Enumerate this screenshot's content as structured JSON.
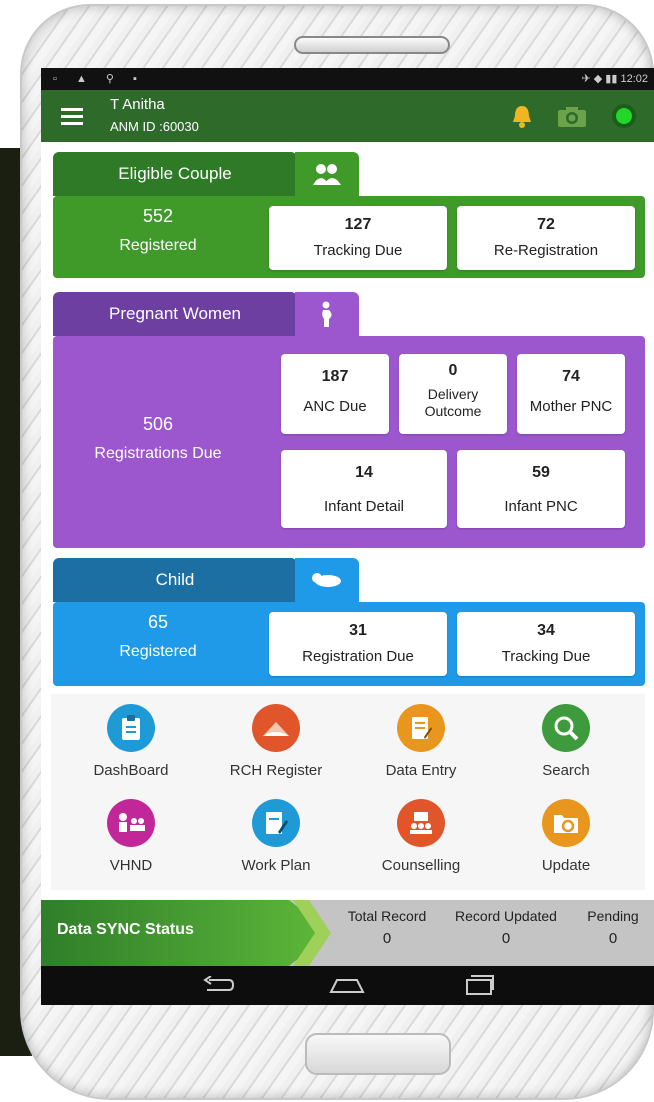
{
  "status_bar": {
    "left_icons": "▫ ▲ ⚲ ▪",
    "time": "12:02"
  },
  "header": {
    "user_name": "T Anitha",
    "anm_id": "ANM ID :60030"
  },
  "eligible_couple": {
    "title": "Eligible Couple",
    "registered_count": "552",
    "registered_label": "Registered",
    "cards": [
      {
        "value": "127",
        "label": "Tracking Due"
      },
      {
        "value": "72",
        "label": "Re-Registration"
      }
    ]
  },
  "pregnant_women": {
    "title": "Pregnant Women",
    "due_count": "506",
    "due_label": "Registrations Due",
    "cards": [
      {
        "value": "187",
        "label": "ANC Due"
      },
      {
        "value": "0",
        "label": "Delivery Outcome"
      },
      {
        "value": "74",
        "label": "Mother PNC"
      },
      {
        "value": "14",
        "label": "Infant Detail"
      },
      {
        "value": "59",
        "label": "Infant PNC"
      }
    ]
  },
  "child": {
    "title": "Child",
    "registered_count": "65",
    "registered_label": "Registered",
    "cards": [
      {
        "value": "31",
        "label": "Registration Due"
      },
      {
        "value": "34",
        "label": "Tracking Due"
      }
    ]
  },
  "menu": [
    {
      "label": "DashBoard",
      "icon": "clipboard-icon",
      "color": "#1e9bd7"
    },
    {
      "label": "RCH Register",
      "icon": "register-book-icon",
      "color": "#e0562a"
    },
    {
      "label": "Data Entry",
      "icon": "document-edit-icon",
      "color": "#e8961e"
    },
    {
      "label": "Search",
      "icon": "search-icon",
      "color": "#3d9b3d"
    },
    {
      "label": "VHND",
      "icon": "group-meeting-icon",
      "color": "#c2279a"
    },
    {
      "label": "Work Plan",
      "icon": "plan-edit-icon",
      "color": "#1e9bd7"
    },
    {
      "label": "Counselling",
      "icon": "counselling-icon",
      "color": "#e0562a"
    },
    {
      "label": "Update",
      "icon": "folder-refresh-icon",
      "color": "#e8961e"
    }
  ],
  "sync": {
    "label": "Data SYNC Status",
    "columns": [
      {
        "title": "Total Record",
        "value": "0"
      },
      {
        "title": "Record Updated",
        "value": "0"
      },
      {
        "title": "Pending",
        "value": "0"
      }
    ]
  },
  "colors": {
    "green": "#3f9a2a",
    "dark_green": "#2e6b2a",
    "purple": "#9c57cf",
    "dark_purple": "#6c3fa0",
    "blue": "#1f9ae8",
    "dark_blue": "#1b6fa3"
  }
}
